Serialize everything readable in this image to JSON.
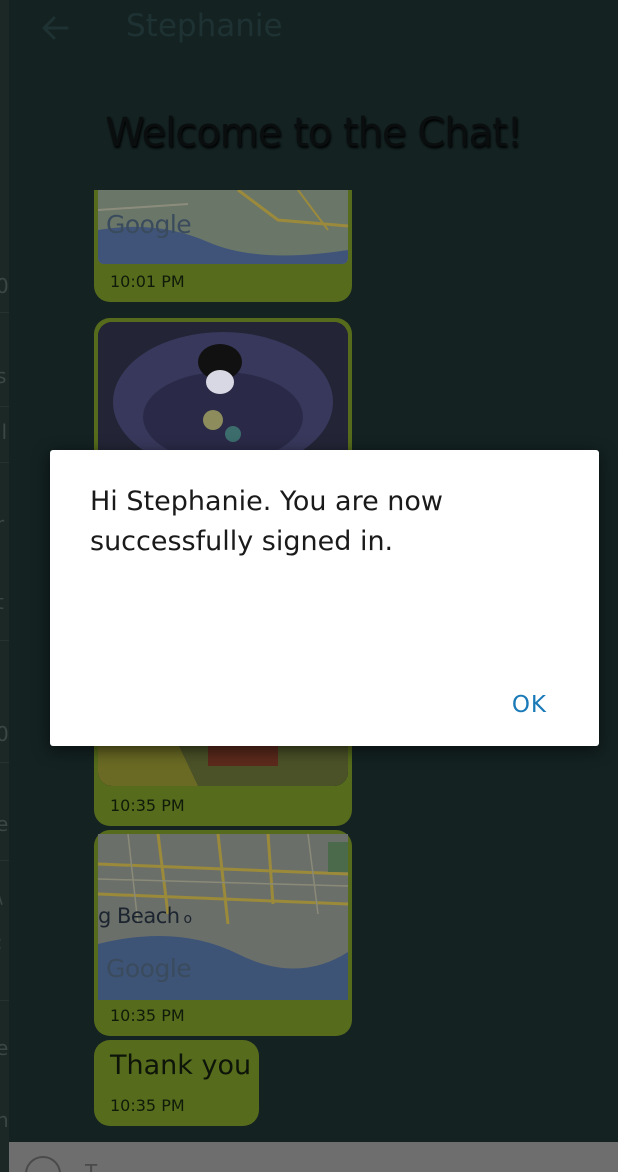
{
  "header": {
    "contact_name": "Stephanie",
    "welcome_title": "Welcome to the Chat!"
  },
  "messages": {
    "map1": {
      "map_brand": "Google",
      "time": "10:01 PM"
    },
    "photo": {
      "time": "10:35 PM"
    },
    "map2": {
      "place_label": "g Beach",
      "map_brand": "Google",
      "time": "10:35 PM"
    },
    "text": {
      "body": "Thank you",
      "time": "10:35 PM"
    }
  },
  "dialog": {
    "message": "Hi Stephanie. You are now successfully signed in.",
    "ok_label": "OK"
  },
  "input": {
    "placeholder": "T"
  },
  "sliver": [
    "0.",
    "s",
    "il",
    "r",
    "t",
    "0.",
    "e",
    "\\",
    ":",
    "e",
    "n"
  ],
  "colors": {
    "bubble": "#566b1b",
    "background": "#142222",
    "dialog_button": "#1a7ab8"
  }
}
